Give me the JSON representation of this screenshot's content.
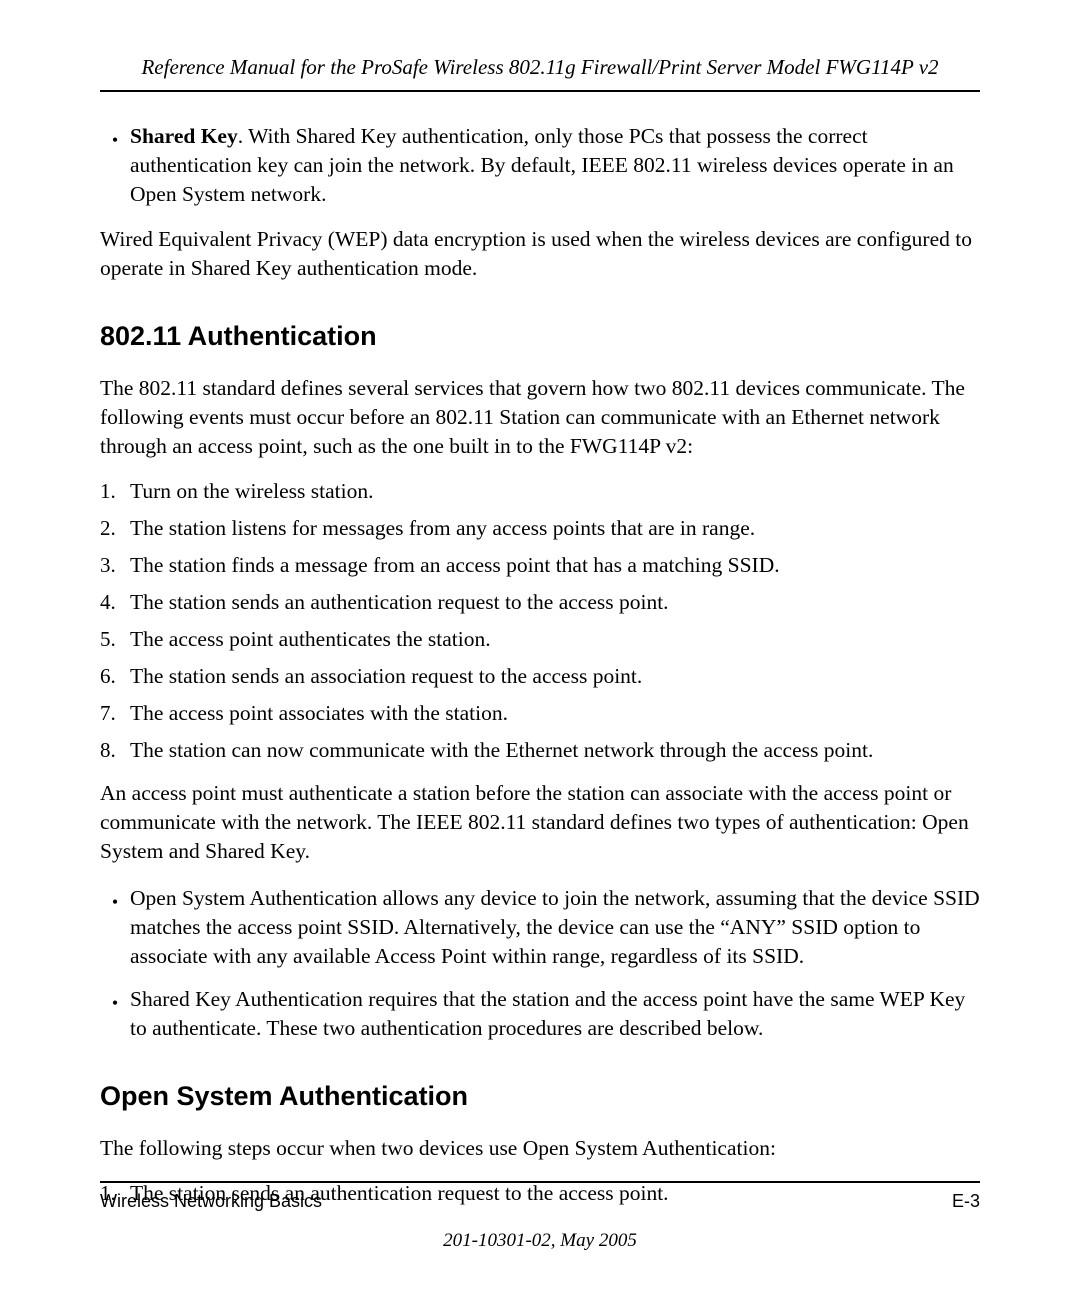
{
  "header": {
    "title": "Reference Manual for the ProSafe Wireless 802.11g  Firewall/Print Server Model FWG114P v2"
  },
  "section1": {
    "bullet1": {
      "term": "Shared Key",
      "text": ". With Shared Key authentication, only those PCs that possess the correct authentication key can join the network. By default, IEEE 802.11 wireless devices operate in an Open System network."
    },
    "para1": "Wired Equivalent Privacy (WEP) data encryption is used when the wireless devices are configured to operate in Shared Key authentication mode."
  },
  "section2": {
    "heading": "802.11 Authentication",
    "intro": "The 802.11 standard defines several services that govern how two 802.11 devices communicate. The following events must occur before an 802.11 Station can communicate with an Ethernet network through an access point, such as the one built in to the FWG114P v2:",
    "steps": [
      "Turn on the wireless station.",
      "The station listens for messages from any access points that are in range.",
      "The station finds a message from an access point that has a matching SSID.",
      "The station sends an authentication request to the access point.",
      "The access point authenticates the station.",
      "The station sends an association request to the access point.",
      "The access point associates with the station.",
      "The station can now communicate with the Ethernet network through the access point."
    ],
    "para2": "An access point must authenticate a station before the station can associate with the access point or communicate with the network. The IEEE 802.11 standard defines two types of authentication: Open System and Shared Key.",
    "bullets": [
      "Open System Authentication allows any device to join the network, assuming that the device SSID matches the access point SSID. Alternatively, the device can use the “ANY” SSID option to associate with any available Access Point within range, regardless of its SSID.",
      "Shared Key Authentication requires that the station and the access point have the same WEP Key to authenticate. These two authentication procedures are described below."
    ]
  },
  "section3": {
    "heading": "Open System Authentication",
    "intro": "The following steps occur when two devices use Open System Authentication:",
    "steps": [
      "The station sends an authentication request to the access point."
    ]
  },
  "footer": {
    "left": "Wireless Networking Basics",
    "right": "E-3",
    "docnum": "201-10301-02, May 2005"
  },
  "labels": {
    "n1": "1.",
    "n2": "2.",
    "n3": "3.",
    "n4": "4.",
    "n5": "5.",
    "n6": "6.",
    "n7": "7.",
    "n8": "8."
  }
}
